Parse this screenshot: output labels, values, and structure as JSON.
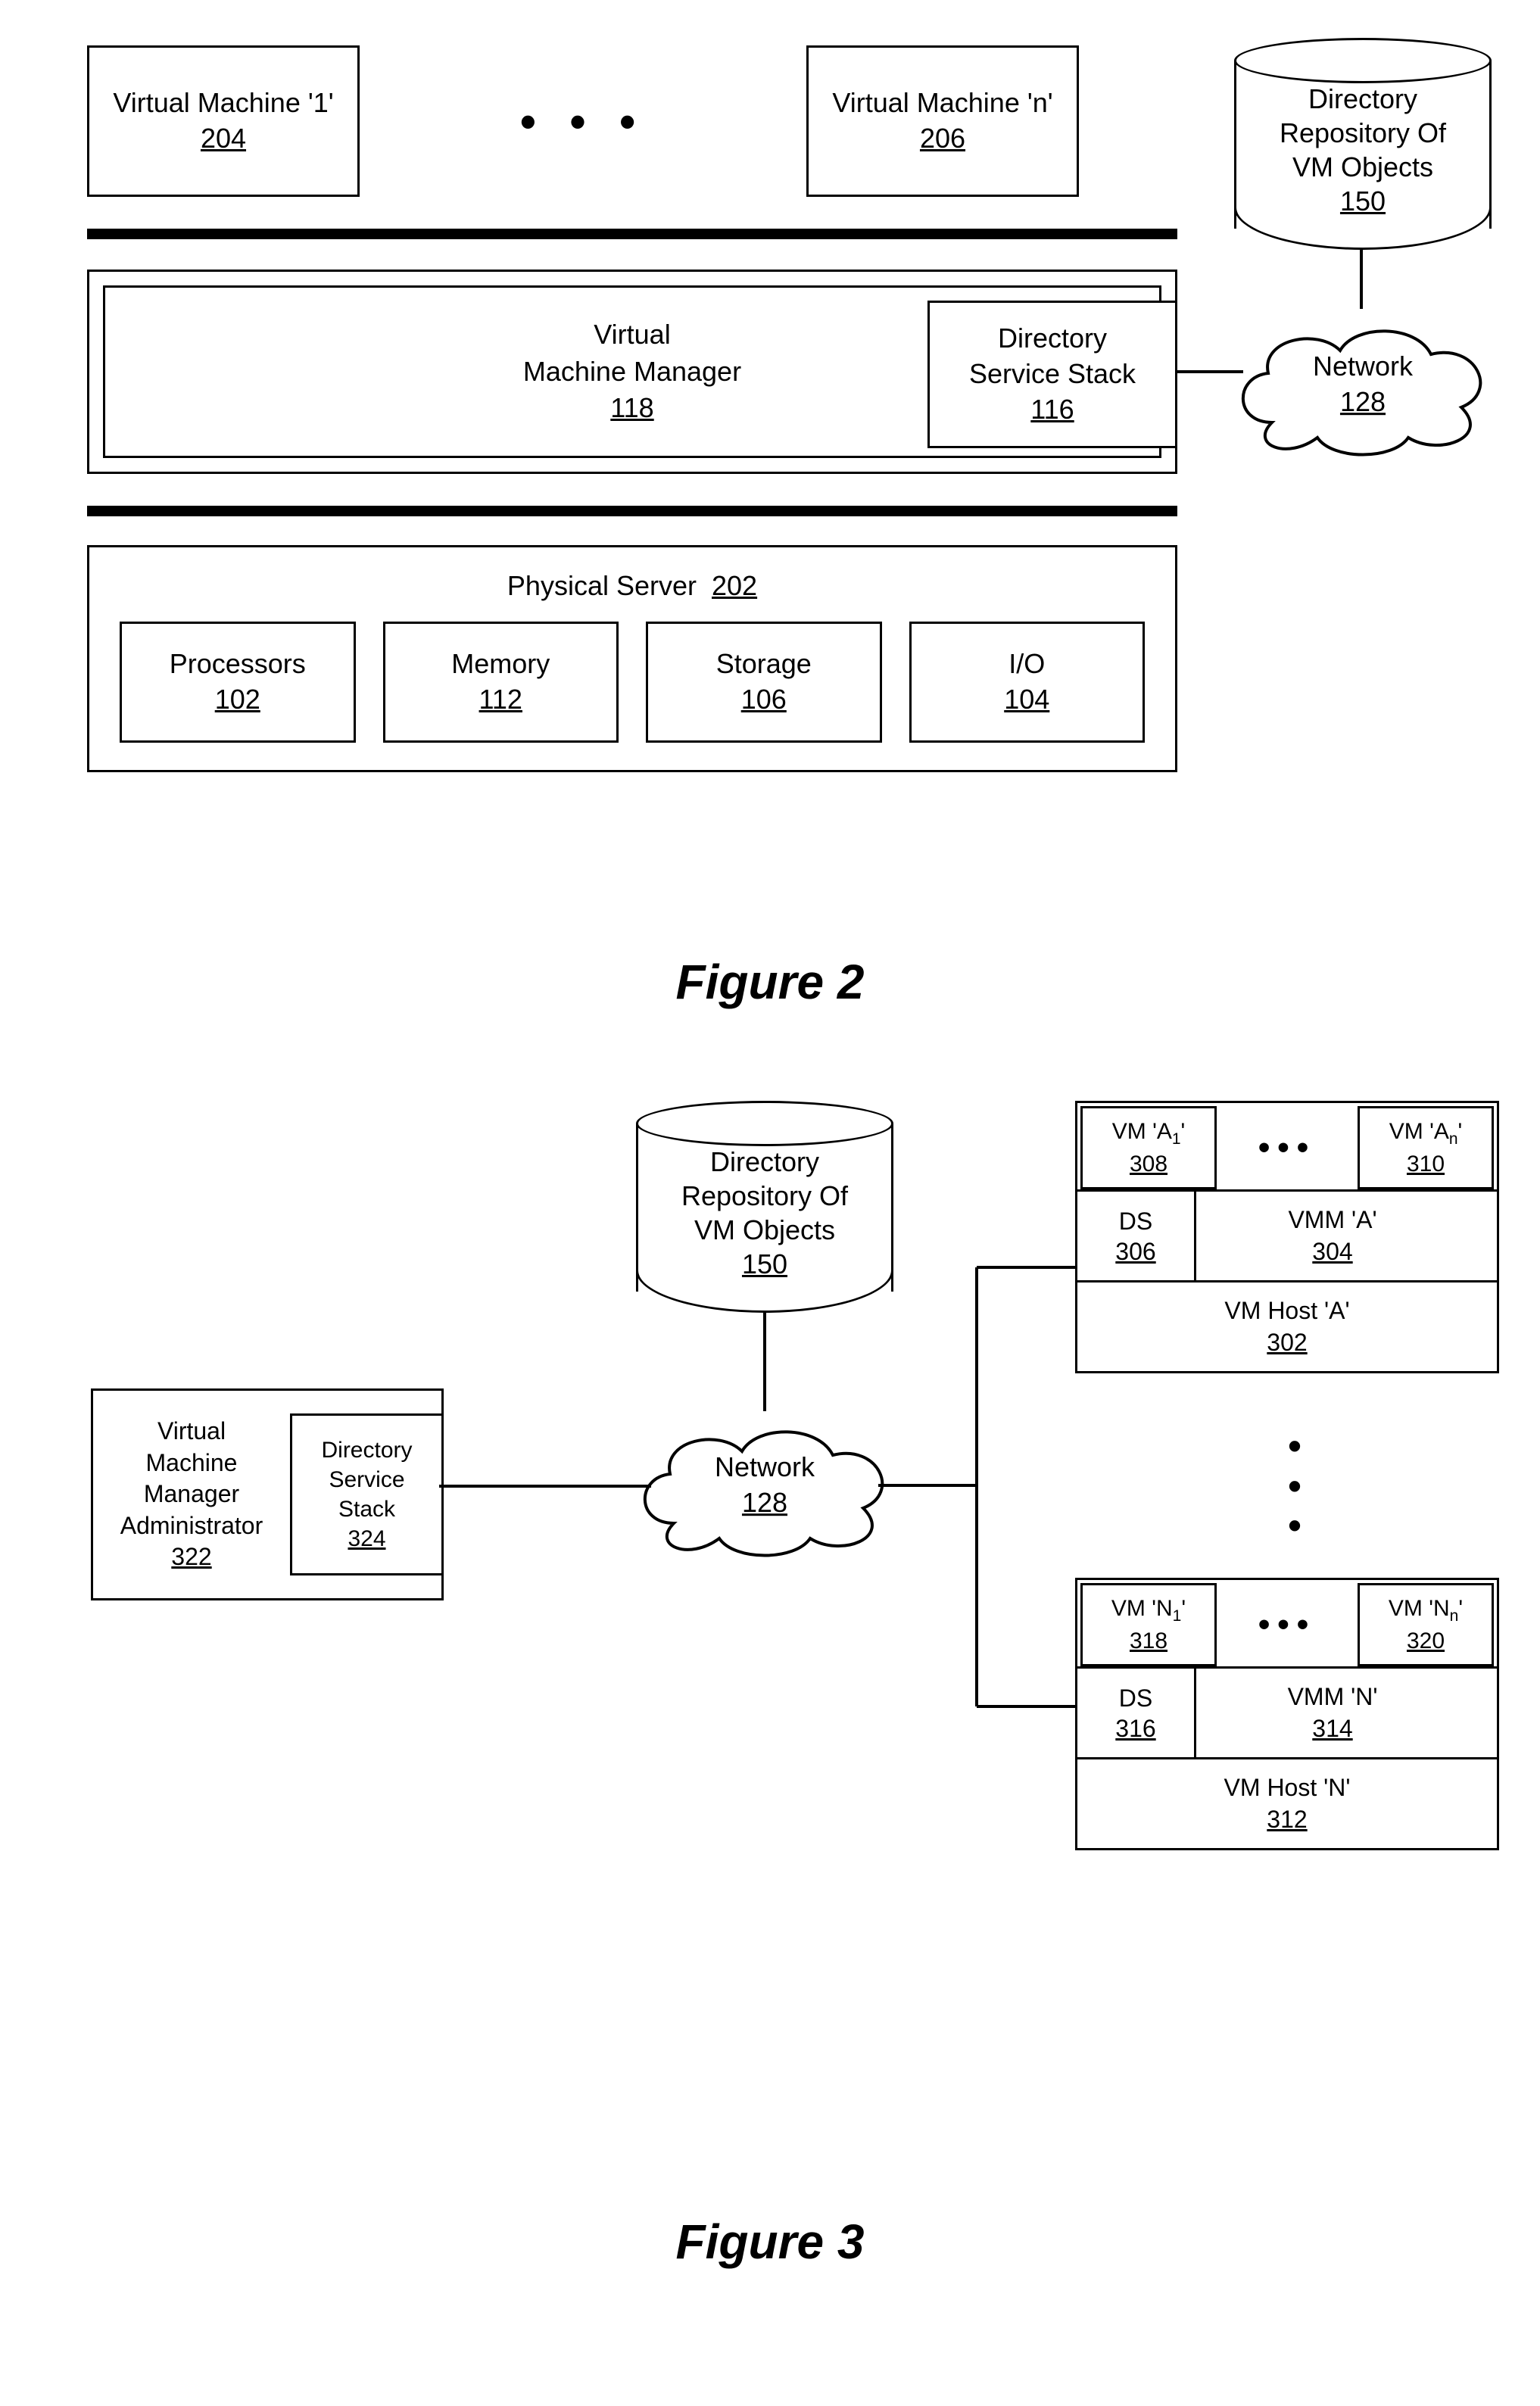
{
  "figure2": {
    "vm1": {
      "label": "Virtual Machine '1'",
      "ref": "204"
    },
    "vmn": {
      "label": "Virtual Machine 'n'",
      "ref": "206"
    },
    "repo": {
      "line1": "Directory",
      "line2": "Repository Of",
      "line3": "VM Objects",
      "ref": "150"
    },
    "vmm": {
      "line1": "Virtual",
      "line2": "Machine Manager",
      "ref": "118"
    },
    "dss": {
      "line1": "Directory",
      "line2": "Service Stack",
      "ref": "116"
    },
    "network": {
      "label": "Network",
      "ref": "128"
    },
    "phys": {
      "title": "Physical Server",
      "ref": "202"
    },
    "processors": {
      "label": "Processors",
      "ref": "102"
    },
    "memory": {
      "label": "Memory",
      "ref": "112"
    },
    "storage": {
      "label": "Storage",
      "ref": "106"
    },
    "io": {
      "label": "I/O",
      "ref": "104"
    },
    "caption": "Figure 2"
  },
  "figure3": {
    "repo": {
      "line1": "Directory",
      "line2": "Repository Of",
      "line3": "VM Objects",
      "ref": "150"
    },
    "network": {
      "label": "Network",
      "ref": "128"
    },
    "vmma": {
      "line1": "Virtual",
      "line2": "Machine",
      "line3": "Manager",
      "line4": "Administrator",
      "ref": "322"
    },
    "dss": {
      "line1": "Directory",
      "line2": "Service",
      "line3": "Stack",
      "ref": "324"
    },
    "hostA": {
      "vm1_label": "VM 'A",
      "vm1_sub": "1",
      "vm1_tail": "'",
      "vm1_ref": "308",
      "vmn_label": "VM 'A",
      "vmn_sub": "n",
      "vmn_tail": "'",
      "vmn_ref": "310",
      "ds": "DS",
      "ds_ref": "306",
      "vmm": "VMM 'A'",
      "vmm_ref": "304",
      "host": "VM Host 'A'",
      "host_ref": "302"
    },
    "hostN": {
      "vm1_label": "VM 'N",
      "vm1_sub": "1",
      "vm1_tail": "'",
      "vm1_ref": "318",
      "vmn_label": "VM 'N",
      "vmn_sub": "n",
      "vmn_tail": "'",
      "vmn_ref": "320",
      "ds": "DS",
      "ds_ref": "316",
      "vmm": "VMM 'N'",
      "vmm_ref": "314",
      "host": "VM Host 'N'",
      "host_ref": "312"
    },
    "caption": "Figure 3"
  }
}
